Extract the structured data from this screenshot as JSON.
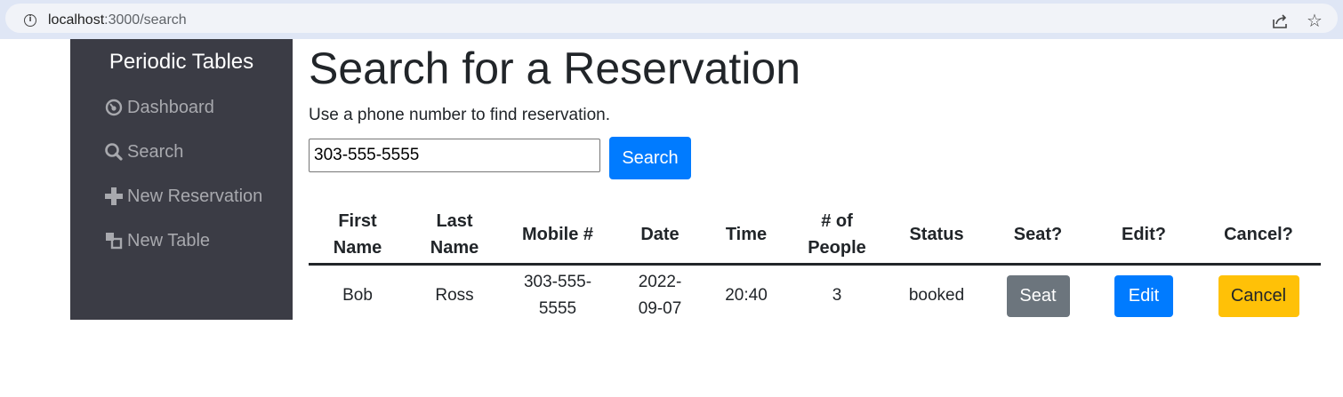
{
  "browser": {
    "url_host": "localhost",
    "url_path": ":3000/search"
  },
  "sidebar": {
    "brand": "Periodic Tables",
    "items": [
      {
        "label": "Dashboard",
        "icon": "dashboard-icon"
      },
      {
        "label": "Search",
        "icon": "search-icon"
      },
      {
        "label": "New Reservation",
        "icon": "plus-icon"
      },
      {
        "label": "New Table",
        "icon": "table-icon"
      }
    ]
  },
  "main": {
    "title": "Search for a Reservation",
    "subtitle": "Use a phone number to find reservation.",
    "search_value": "303-555-5555",
    "search_button": "Search"
  },
  "table": {
    "headers": [
      "First Name",
      "Last Name",
      "Mobile #",
      "Date",
      "Time",
      "# of People",
      "Status",
      "Seat?",
      "Edit?",
      "Cancel?"
    ],
    "rows": [
      {
        "first_name": "Bob",
        "last_name": "Ross",
        "mobile": "303-555-5555",
        "date": "2022-09-07",
        "time": "20:40",
        "people": "3",
        "status": "booked",
        "seat_label": "Seat",
        "edit_label": "Edit",
        "cancel_label": "Cancel"
      }
    ]
  },
  "colors": {
    "sidebar_bg": "#3b3c45",
    "primary": "#007bff",
    "secondary": "#6c757d",
    "warning": "#ffc107"
  }
}
